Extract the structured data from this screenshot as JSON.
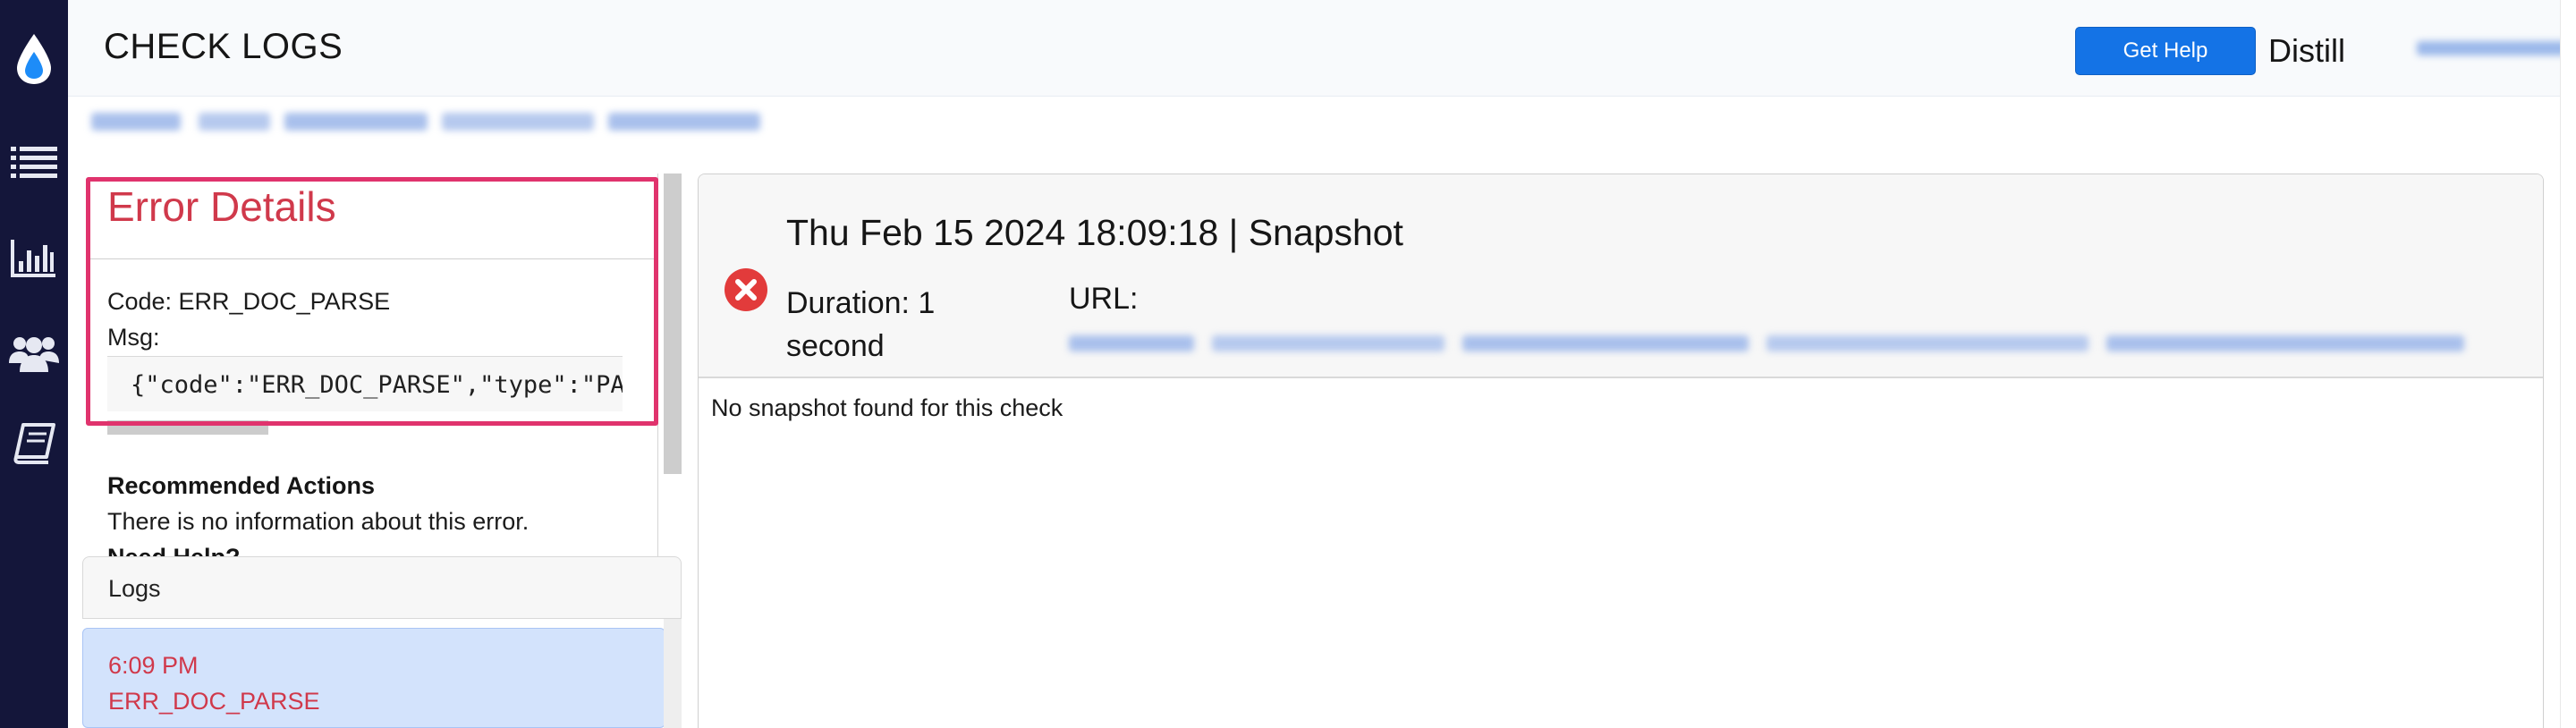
{
  "header": {
    "title": "CHECK LOGS",
    "help_label": "Get Help",
    "brand": "Distill"
  },
  "sidebar": {
    "items": [
      {
        "icon": "drop-logo-icon"
      },
      {
        "icon": "list-icon"
      },
      {
        "icon": "bar-chart-icon"
      },
      {
        "icon": "users-icon"
      },
      {
        "icon": "book-icon"
      }
    ]
  },
  "error": {
    "heading": "Error Details",
    "code_line": "Code: ERR_DOC_PARSE",
    "msg_label": "Msg:",
    "msg_value": "{\"code\":\"ERR_DOC_PARSE\",\"type\":\"PARSE\"}",
    "recommended_heading": "Recommended Actions",
    "recommended_text": "There is no information about this error.",
    "need_help": "Need Help?"
  },
  "logs": {
    "title": "Logs",
    "items": [
      {
        "time": "6:09 PM",
        "code": "ERR_DOC_PARSE"
      }
    ]
  },
  "snapshot": {
    "title": "Thu Feb 15 2024 18:09:18 | Snapshot",
    "status_icon": "error-x-icon",
    "duration": "Duration: 1 second",
    "url_label": "URL:",
    "empty_text": "No snapshot found for this check"
  },
  "colors": {
    "sidebar_bg": "#14163a",
    "accent": "#1473e6",
    "error_red": "#d0394b",
    "highlight_pink": "#e0336d",
    "selected_row": "#d3e3fc"
  }
}
